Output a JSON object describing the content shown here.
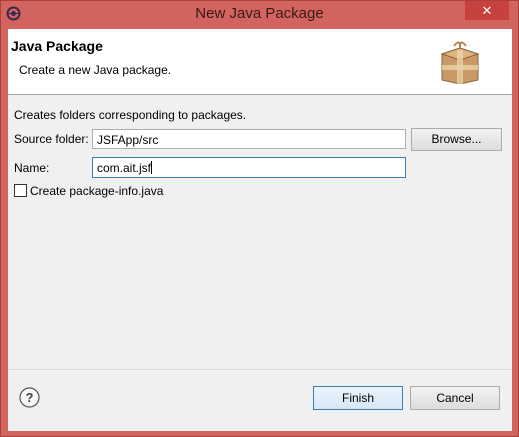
{
  "window": {
    "title": "New Java Package",
    "close_label": "✕"
  },
  "header": {
    "title": "Java Package",
    "description": "Create a new Java package."
  },
  "form": {
    "intro": "Creates folders corresponding to packages.",
    "source_folder_label": "Source folder:",
    "source_folder_value": "JSFApp/src",
    "browse_label": "Browse...",
    "name_label": "Name:",
    "name_value": "com.ait.jsf",
    "package_info_label": "Create package-info.java",
    "package_info_checked": false
  },
  "footer": {
    "finish_label": "Finish",
    "cancel_label": "Cancel"
  },
  "icons": {
    "app": "eclipse-icon",
    "banner": "package-box-icon",
    "help": "help-icon"
  },
  "colors": {
    "titlebar": "#d2635e",
    "close_button": "#c7423d",
    "dialog_bg": "#f0f0f0",
    "focus_border": "#3c7fb1"
  }
}
